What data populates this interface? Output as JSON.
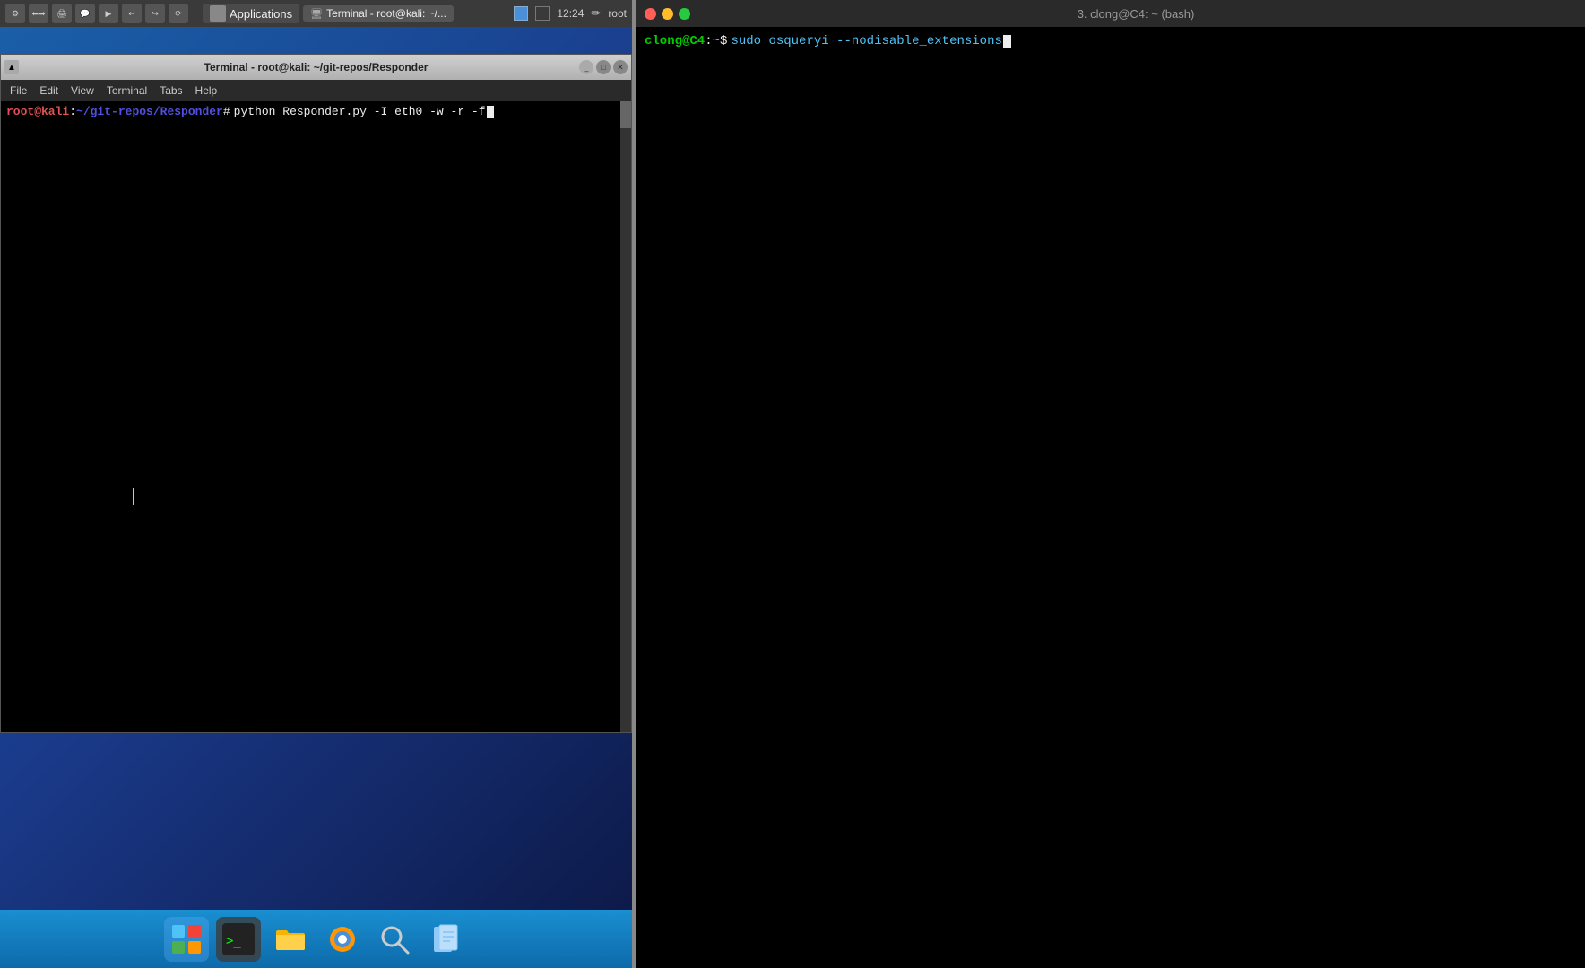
{
  "kali": {
    "menubar": {
      "applications_label": "Applications",
      "terminal_tab_label": "Terminal - root@kali: ~/...",
      "time": "12:24",
      "username": "root"
    },
    "terminal_window": {
      "title": "Terminal - root@kali: ~/git-repos/Responder",
      "menu_items": [
        "File",
        "Edit",
        "View",
        "Terminal",
        "Tabs",
        "Help"
      ],
      "prompt": {
        "user": "root@kali",
        "path": "~/git-repos/Responder",
        "command": "python Responder.py -I eth0 -w -r -f"
      }
    },
    "dock": {
      "items": [
        {
          "name": "files-icon",
          "symbol": "🗂"
        },
        {
          "name": "terminal-icon",
          "symbol": "⬛"
        },
        {
          "name": "folder-icon",
          "symbol": "📁"
        },
        {
          "name": "browser-icon",
          "symbol": "🦊"
        },
        {
          "name": "search-icon",
          "symbol": "🔍"
        },
        {
          "name": "files2-icon",
          "symbol": "📂"
        }
      ]
    }
  },
  "mac": {
    "titlebar": {
      "title": "3. clong@C4: ~ (bash)"
    },
    "terminal": {
      "prompt": {
        "user": "clong@C4",
        "path": "~",
        "command": "sudo osqueryi --nodisable_extensions"
      }
    }
  }
}
